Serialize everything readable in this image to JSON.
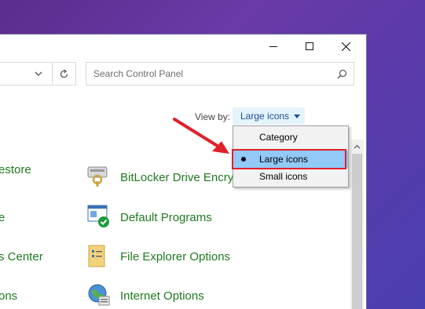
{
  "window": {
    "minimize_icon": "minimize-icon",
    "maximize_icon": "maximize-icon",
    "close_icon": "close-icon"
  },
  "address_bar": {
    "chevron_icon": "chevron-down-icon",
    "refresh_icon": "refresh-icon"
  },
  "search": {
    "placeholder": "Search Control Panel",
    "icon": "search-icon"
  },
  "view_by": {
    "label": "View by:",
    "selected": "Large icons"
  },
  "dropdown": {
    "options": [
      "Category",
      "Large icons",
      "Small icons"
    ],
    "selected_index": 1
  },
  "items_left": [
    {
      "label": "estore"
    },
    {
      "label": "e"
    },
    {
      "label": "s Center"
    },
    {
      "label": "ons"
    }
  ],
  "items_right": [
    {
      "label": "BitLocker Drive Encryption",
      "icon": "bitlocker-icon"
    },
    {
      "label": "Default Programs",
      "icon": "default-programs-icon"
    },
    {
      "label": "File Explorer Options",
      "icon": "file-explorer-options-icon"
    },
    {
      "label": "Internet Options",
      "icon": "internet-options-icon"
    }
  ],
  "annotation": {
    "arrow_color": "#e0202a",
    "highlight_color": "#e0202a"
  }
}
